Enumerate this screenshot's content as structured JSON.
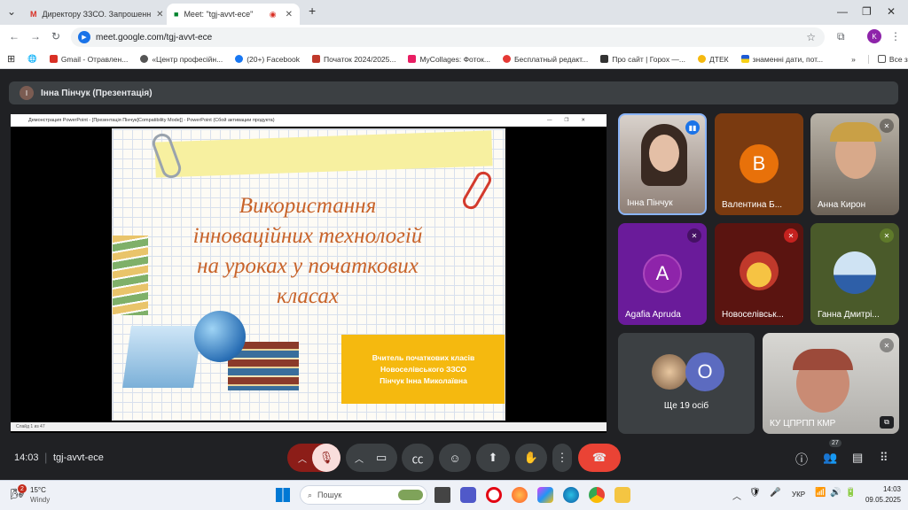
{
  "browser": {
    "tabs": [
      {
        "title": "Директору ЗЗСО. Запрошенн",
        "icon": "gmail-icon"
      },
      {
        "title": "Meet: \"tgj-avvt-ece\"",
        "icon": "meet-icon"
      }
    ],
    "new_tab_label": "+",
    "url": "meet.google.com/tgj-avvt-ece",
    "profile_initial": "K",
    "bookmarks": [
      "Gmail - Отравлен...",
      "«Центр професійн...",
      "(20+) Facebook",
      "Початок 2024/2025...",
      "MyCollages: Фоток...",
      "Бесплатный редакт...",
      "Про сайт | Горох —...",
      "ДТЕК",
      "знаменні дати, пот..."
    ],
    "all_bookmarks_label": "Все закладки"
  },
  "meet": {
    "presenter_initial": "І",
    "presenter_label": "Інна Пінчук (Презентація)",
    "ppt_window_title": "Демонстрация PowerPoint - [Презентація Пінчук[Compatibility Mode]] - PowerPoint (Сбой активации продукта)",
    "ppt_status": "Слайд 1 из 47",
    "slide": {
      "title_lines": [
        "Використання",
        "інноваційних технологій",
        "на уроках  у початкових",
        "класах"
      ],
      "info_lines": [
        "Вчитель початкових класів",
        "Новоселівського ЗЗСО",
        "Пінчук Інна Миколаївна"
      ]
    },
    "participants": [
      {
        "name": "Інна Пінчук",
        "kind": "video",
        "speaking": true
      },
      {
        "name": "Валентина Б...",
        "kind": "avatar",
        "initial": "В",
        "color": "#e8710a",
        "bg": "#7a3a10"
      },
      {
        "name": "Анна Кирон",
        "kind": "video",
        "muted": true
      },
      {
        "name": "Agafia Apruda",
        "kind": "avatar",
        "initial": "A",
        "color": "#8e24aa",
        "bg": "#6a1b9a",
        "muted": true
      },
      {
        "name": "Новоселівськ...",
        "kind": "image",
        "muted": true
      },
      {
        "name": "Ганна Дмитрі...",
        "kind": "image",
        "muted": true
      }
    ],
    "others_label": "Ще 19 осіб",
    "others_initial": "O",
    "last_tile_name": "КУ ЦПРПП КМР",
    "time": "14:03",
    "meeting_code": "tgj-avvt-ece",
    "people_count": "27"
  },
  "taskbar": {
    "weather_temp": "15°C",
    "weather_text": "Windy",
    "weather_badge": "2",
    "search_placeholder": "Пошук",
    "lang": "УКР",
    "clock_time": "14:03",
    "clock_date": "09.05.2025"
  },
  "colors": {
    "meet_bg": "#202124",
    "end_call": "#ea4335",
    "mic_off": "#f9dedc",
    "slide_title": "#c8632a",
    "slide_info_bg": "#f5b90f"
  }
}
